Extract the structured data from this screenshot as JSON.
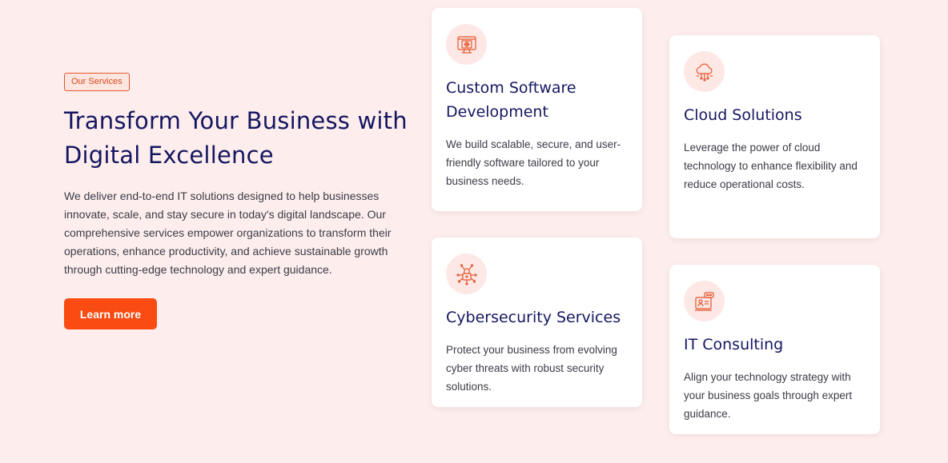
{
  "intro": {
    "tag": "Our Services",
    "title": "Transform Your Business with Digital Excellence",
    "description": "We deliver end-to-end IT solutions designed to help businesses innovate, scale, and stay secure in today's digital landscape. Our comprehensive services empower organizations to transform their operations, enhance productivity, and achieve sustainable growth through cutting-edge technology and expert guidance.",
    "button_label": "Learn more"
  },
  "services": [
    {
      "icon": "software-development-icon",
      "title": "Custom Software Development",
      "text": "We build scalable, secure, and user-friendly software tailored to your business needs."
    },
    {
      "icon": "cloud-icon",
      "title": "Cloud Solutions",
      "text": "Leverage the power of cloud technology to enhance flexibility and reduce operational costs."
    },
    {
      "icon": "cybersecurity-lock-icon",
      "title": "Cybersecurity Services",
      "text": "Protect your business from evolving cyber threats with robust security solutions."
    },
    {
      "icon": "consulting-icon",
      "title": "IT Consulting",
      "text": "Align your technology strategy with your business goals through expert guidance."
    }
  ],
  "colors": {
    "background": "#fdeeed",
    "accent": "#fa4c12",
    "heading": "#151660"
  }
}
